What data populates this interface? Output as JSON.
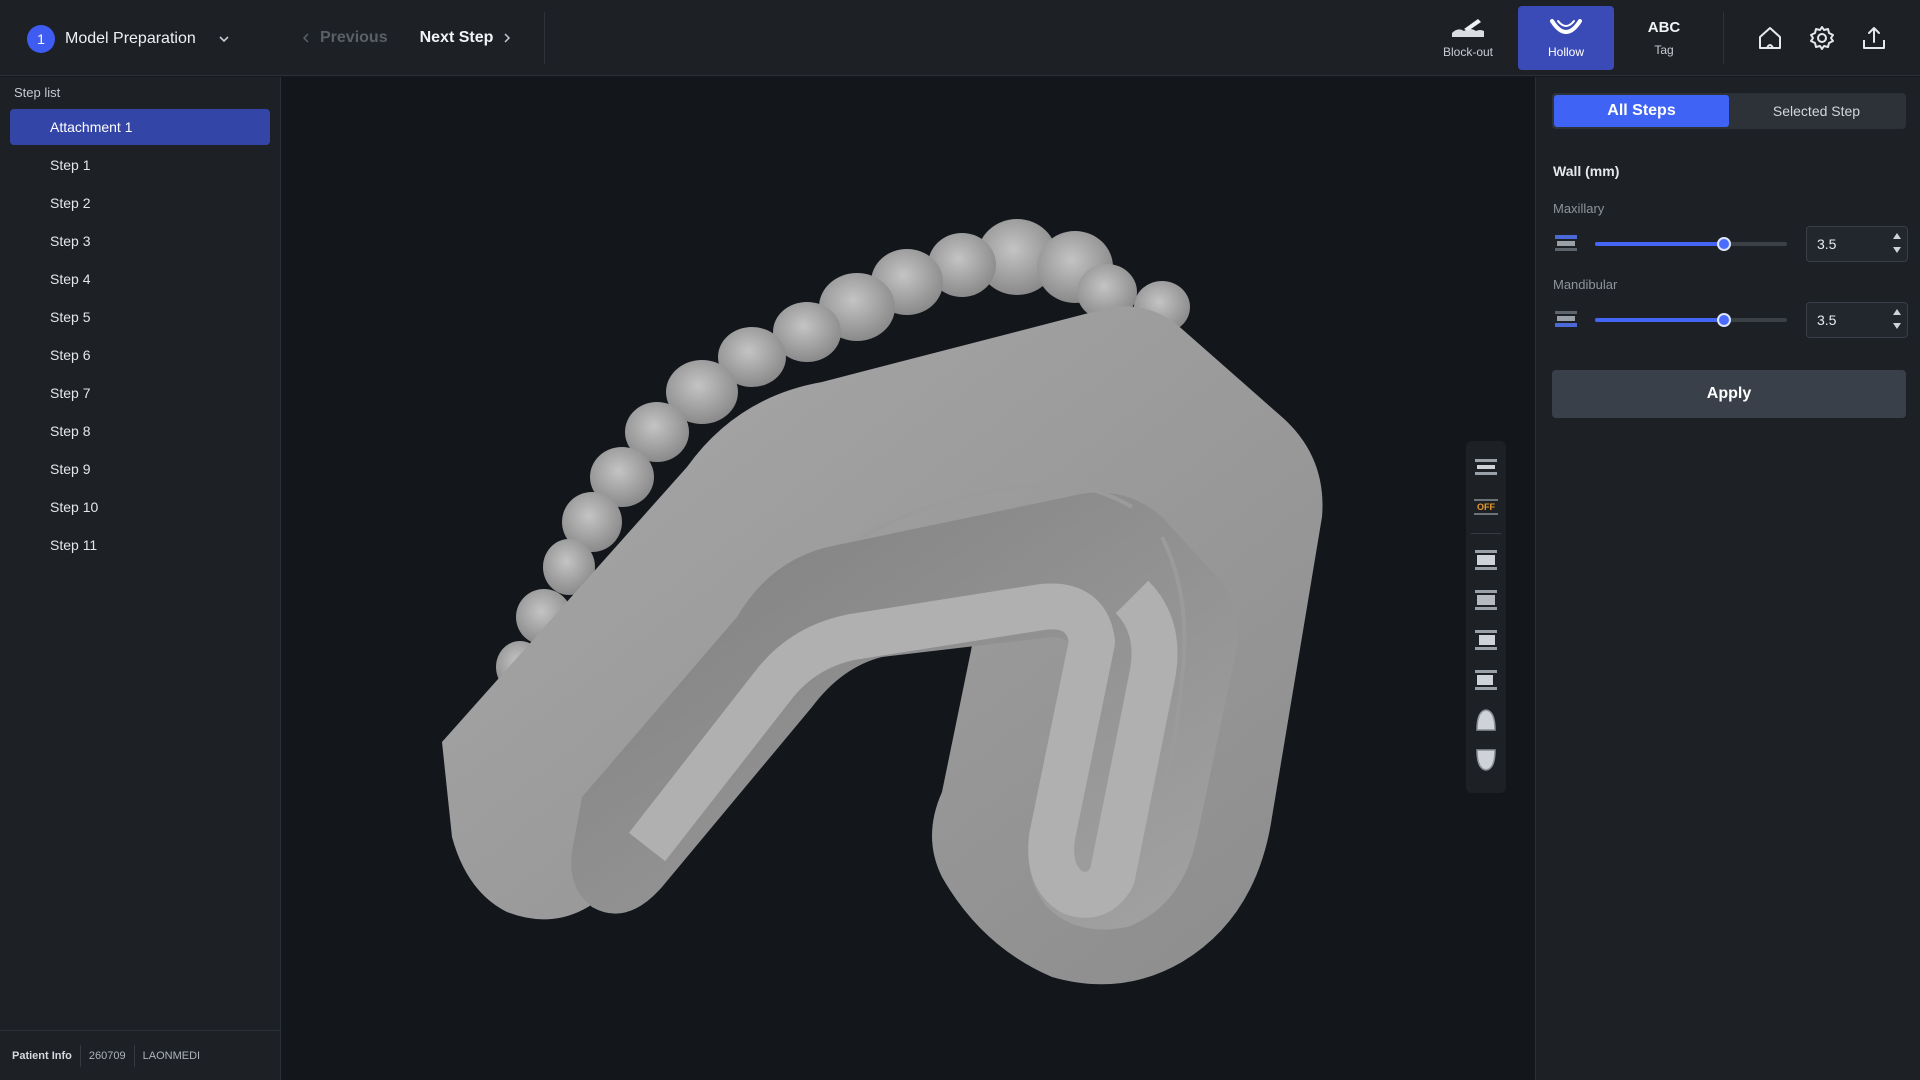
{
  "header": {
    "stage_number": "1",
    "stage_title": "Model Preparation",
    "prev_label": "Previous",
    "next_label": "Next Step",
    "tools": [
      {
        "label": "Block-out",
        "icon": "block-out-icon",
        "active": false
      },
      {
        "label": "Hollow",
        "icon": "hollow-icon",
        "active": true
      },
      {
        "label": "Tag",
        "icon_text": "ABC",
        "active": false
      }
    ],
    "action_icons": [
      "home-icon",
      "settings-icon",
      "export-icon"
    ]
  },
  "sidebar": {
    "title": "Step list",
    "items": [
      {
        "label": "Attachment 1",
        "selected": true
      },
      {
        "label": "Step 1"
      },
      {
        "label": "Step 2"
      },
      {
        "label": "Step 3"
      },
      {
        "label": "Step 4"
      },
      {
        "label": "Step 5"
      },
      {
        "label": "Step 6"
      },
      {
        "label": "Step 7"
      },
      {
        "label": "Step 8"
      },
      {
        "label": "Step 9"
      },
      {
        "label": "Step 10"
      },
      {
        "label": "Step 11"
      }
    ],
    "footer": {
      "label": "Patient Info",
      "patient_id": "260709",
      "clinic": "LAONMEDI"
    }
  },
  "viewport": {
    "toolbar": {
      "off_label": "OFF"
    }
  },
  "panel": {
    "scope_tabs": {
      "all": "All Steps",
      "selected": "Selected Step",
      "active": "all"
    },
    "wall_title": "Wall (mm)",
    "maxillary": {
      "label": "Maxillary",
      "value": "3.5",
      "slider_fraction": 0.67
    },
    "mandibular": {
      "label": "Mandibular",
      "value": "3.5",
      "slider_fraction": 0.67
    },
    "apply_label": "Apply"
  },
  "colors": {
    "accent": "#3f63f5",
    "selected_item": "#3445a8",
    "background": "#15181c",
    "panel": "#1d2126",
    "model": "#9a9a9a"
  }
}
